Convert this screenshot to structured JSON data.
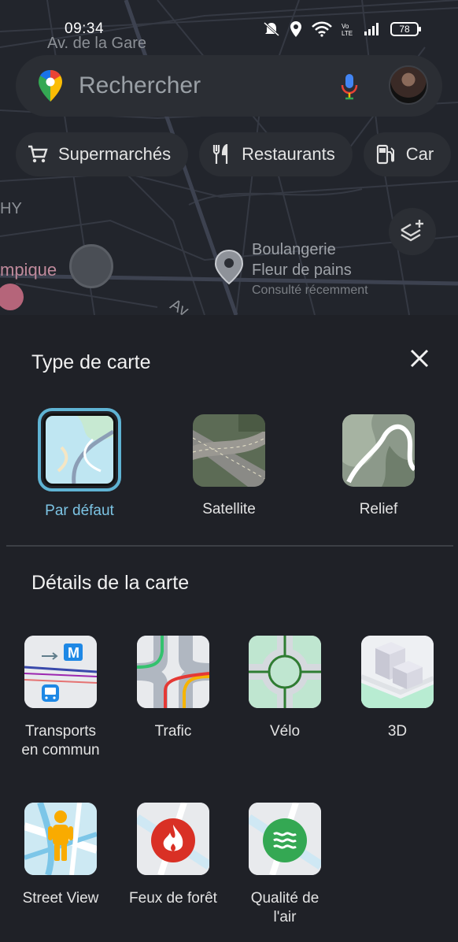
{
  "status_bar": {
    "time": "09:34",
    "battery": "78"
  },
  "search": {
    "placeholder": "Rechercher"
  },
  "chips": [
    {
      "label": "Supermarchés",
      "icon": "cart-icon"
    },
    {
      "label": "Restaurants",
      "icon": "fork-knife-icon"
    },
    {
      "label": "Car",
      "icon": "fuel-icon"
    }
  ],
  "map": {
    "street_labels": [
      "Av. de la Gare",
      "HY",
      "mpique",
      "Av"
    ],
    "poi": {
      "name_line1": "Boulangerie",
      "name_line2": "Fleur de pains",
      "subtitle": "Consulté récemment"
    }
  },
  "sheet": {
    "map_type_title": "Type de carte",
    "map_types": [
      {
        "label": "Par défaut",
        "selected": true
      },
      {
        "label": "Satellite",
        "selected": false
      },
      {
        "label": "Relief",
        "selected": false
      }
    ],
    "details_title": "Détails de la carte",
    "details": [
      {
        "label": "Transports en commun",
        "label_line1": "Transports",
        "label_line2": "en commun"
      },
      {
        "label": "Trafic"
      },
      {
        "label": "Vélo"
      },
      {
        "label": "3D"
      },
      {
        "label": "Street View"
      },
      {
        "label": "Feux de forêt"
      },
      {
        "label": "Qualité de l'air",
        "label_line1": "Qualité de",
        "label_line2": "l'air"
      }
    ]
  },
  "colors": {
    "accent": "#7cc4e4",
    "sheet_bg": "#1f2127",
    "chip_bg": "#2b2e34"
  }
}
